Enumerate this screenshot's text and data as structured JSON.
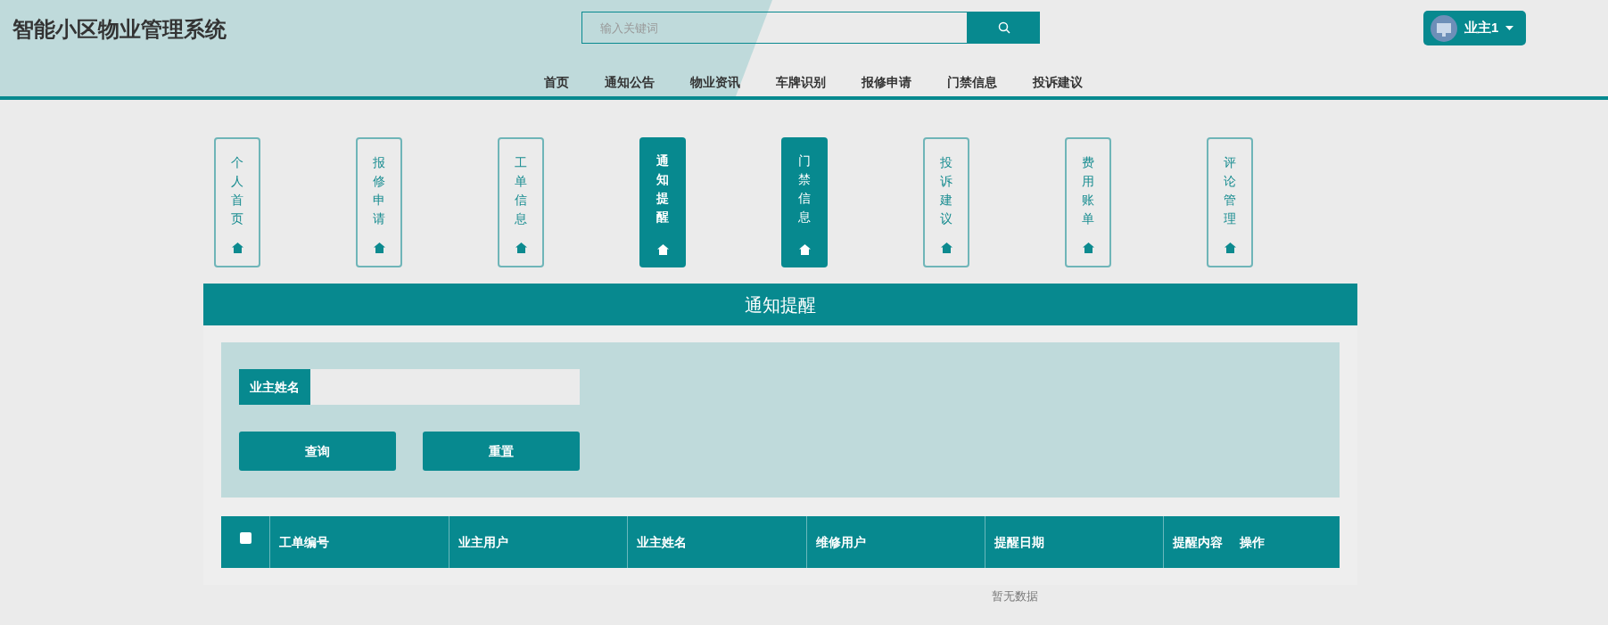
{
  "site_title": "智能小区物业管理系统",
  "search": {
    "placeholder": "输入关键词"
  },
  "user": {
    "name": "业主1"
  },
  "nav": [
    "首页",
    "通知公告",
    "物业资讯",
    "车牌识别",
    "报修申请",
    "门禁信息",
    "投诉建议"
  ],
  "side_tabs": [
    {
      "label": "个人首页",
      "selected": false,
      "hovered": false
    },
    {
      "label": "报修申请",
      "selected": false,
      "hovered": false
    },
    {
      "label": "工单信息",
      "selected": false,
      "hovered": false
    },
    {
      "label": "通知提醒",
      "selected": true,
      "hovered": false
    },
    {
      "label": "门禁信息",
      "selected": false,
      "hovered": true
    },
    {
      "label": "投诉建议",
      "selected": false,
      "hovered": false
    },
    {
      "label": "费用账单",
      "selected": false,
      "hovered": false
    },
    {
      "label": "评论管理",
      "selected": false,
      "hovered": false
    }
  ],
  "panel_title": "通知提醒",
  "filter": {
    "label": "业主姓名",
    "buttons": [
      "查询",
      "重置"
    ]
  },
  "table": {
    "select_all": {
      "checked": false
    },
    "columns": [
      "工单编号",
      "业主用户",
      "业主姓名",
      "维修用户",
      "提醒日期",
      "提醒内容",
      "操作"
    ],
    "empty_text": "暂无数据"
  }
}
